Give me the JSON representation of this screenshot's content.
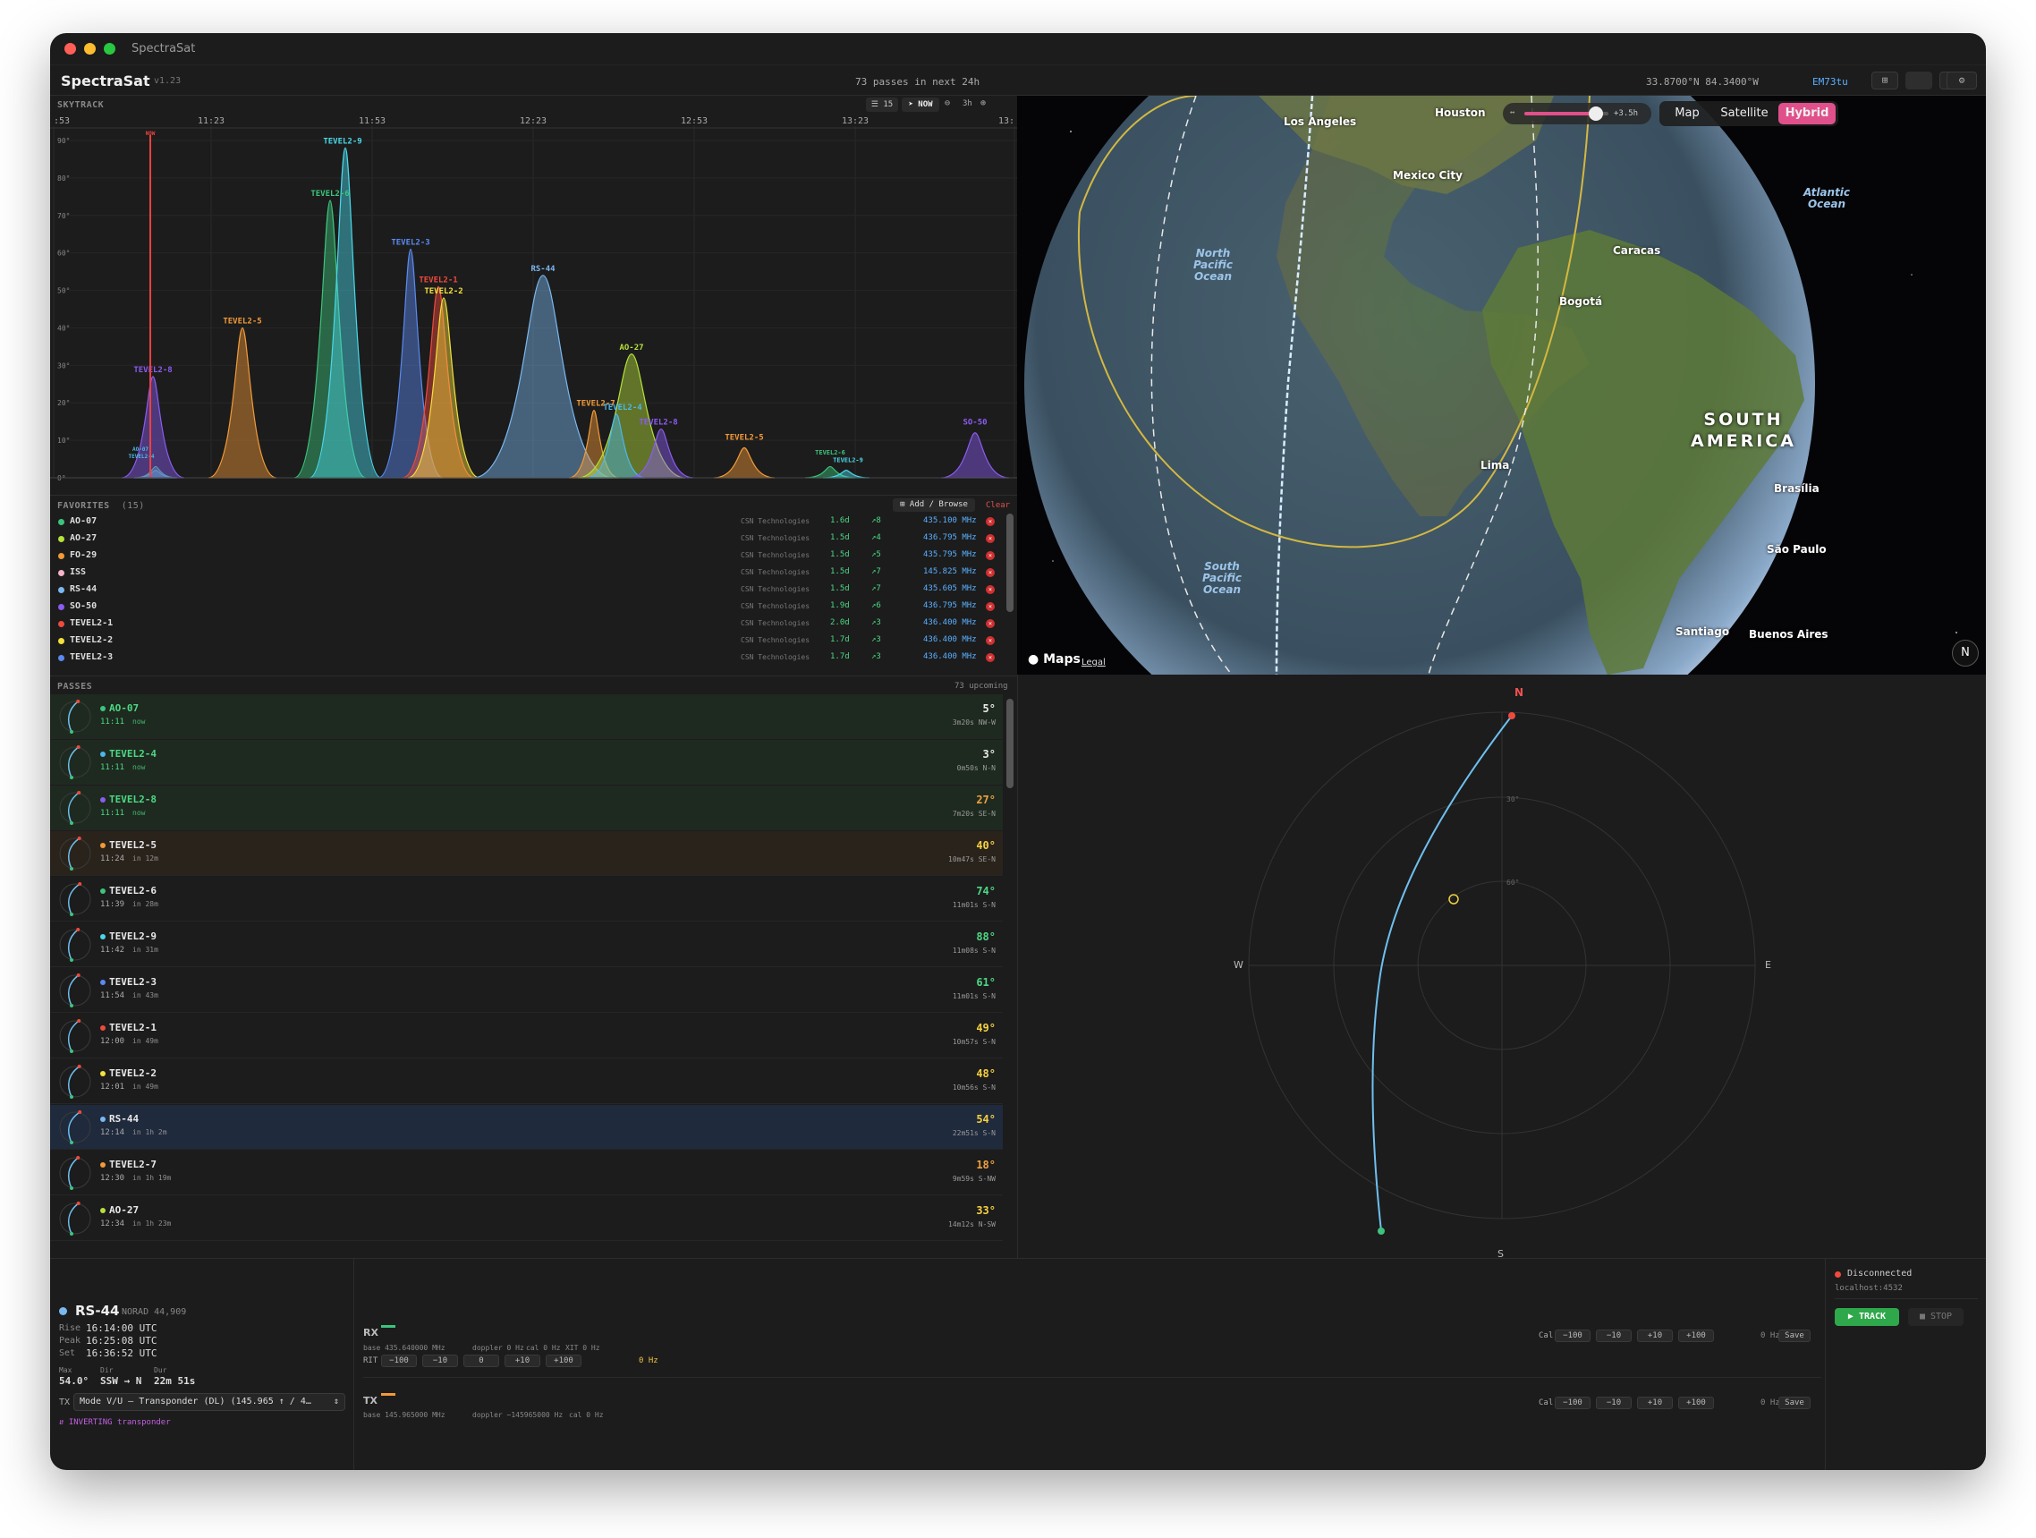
{
  "window": {
    "title": "SpectraSat"
  },
  "appbar": {
    "name": "SpectraSat",
    "version": "v1.23",
    "pass_count": "73 passes in next 24h",
    "coords": "33.8700°N 84.3400°W",
    "grid": "EM73tu"
  },
  "skytrack": {
    "label": "SKYTRACK",
    "count_label": "15",
    "now_label": "NOW",
    "range_label": "3h",
    "time_ticks": [
      ":53",
      "11:23",
      "11:53",
      "12:23",
      "12:53",
      "13:23",
      "13:"
    ],
    "elev_ticks": [
      "90°",
      "80°",
      "70°",
      "60°",
      "50°",
      "40°",
      "30°",
      "20°",
      "10°",
      "0°"
    ],
    "now_marker": "NOW",
    "peak_labels": [
      "TEVEL2-9",
      "TEVEL2-6",
      "TEVEL2-3",
      "TEVEL2-1",
      "TEVEL2-2",
      "TEVEL2-5",
      "RS-44",
      "AO-27",
      "TEVEL2-8",
      "TEVEL2-7",
      "TEVEL2-4",
      "TEVEL2-8",
      "TEVEL2-5",
      "SO-50",
      "TEVEL2-6",
      "TEVEL2-9",
      "AO-07",
      "TEVEL2-4"
    ]
  },
  "favorites": {
    "label": "FAVORITES",
    "count": "(15)",
    "add_label": "Add / Browse",
    "clear_label": "Clear",
    "items": [
      {
        "name": "AO-07",
        "color": "#3cc47c",
        "source": "CSN Technologies",
        "age": "1.6d",
        "passes": "↗8",
        "freq": "435.100 MHz"
      },
      {
        "name": "AO-27",
        "color": "#b6e03c",
        "source": "CSN Technologies",
        "age": "1.5d",
        "passes": "↗4",
        "freq": "436.795 MHz"
      },
      {
        "name": "FO-29",
        "color": "#f29a38",
        "source": "CSN Technologies",
        "age": "1.5d",
        "passes": "↗5",
        "freq": "435.795 MHz"
      },
      {
        "name": "ISS",
        "color": "#f5b4c8",
        "source": "CSN Technologies",
        "age": "1.5d",
        "passes": "↗7",
        "freq": "145.825 MHz"
      },
      {
        "name": "RS-44",
        "color": "#7ab8f0",
        "source": "CSN Technologies",
        "age": "1.5d",
        "passes": "↗7",
        "freq": "435.605 MHz"
      },
      {
        "name": "SO-50",
        "color": "#8a5cf0",
        "source": "CSN Technologies",
        "age": "1.9d",
        "passes": "↗6",
        "freq": "436.795 MHz"
      },
      {
        "name": "TEVEL2-1",
        "color": "#f04a3c",
        "source": "CSN Technologies",
        "age": "2.0d",
        "passes": "↗3",
        "freq": "436.400 MHz"
      },
      {
        "name": "TEVEL2-2",
        "color": "#f5e03c",
        "source": "CSN Technologies",
        "age": "1.7d",
        "passes": "↗3",
        "freq": "436.400 MHz"
      },
      {
        "name": "TEVEL2-3",
        "color": "#5a8af0",
        "source": "CSN Technologies",
        "age": "1.7d",
        "passes": "↗3",
        "freq": "436.400 MHz"
      }
    ]
  },
  "passes": {
    "label": "PASSES",
    "upcoming": "73 upcoming",
    "items": [
      {
        "name": "AO-07",
        "color": "#3cc47c",
        "time": "11:11",
        "rel": "now",
        "elev": "5°",
        "elev_color": "#e8e8e8",
        "dur": "3m20s NW-W",
        "bg": "#1e2a1f",
        "name_color": "#4cd884",
        "time_color": "#4cd884"
      },
      {
        "name": "TEVEL2-4",
        "color": "#4ab8e8",
        "time": "11:11",
        "rel": "now",
        "elev": "3°",
        "elev_color": "#e8e8e8",
        "dur": "0m50s N-N",
        "bg": "#1e2a1f",
        "name_color": "#4cd884",
        "time_color": "#4cd884"
      },
      {
        "name": "TEVEL2-8",
        "color": "#8a5cf0",
        "time": "11:11",
        "rel": "now",
        "elev": "27°",
        "elev_color": "#f0a040",
        "dur": "7m20s SE-N",
        "bg": "#1e2a1f",
        "name_color": "#4cd884",
        "time_color": "#4cd884"
      },
      {
        "name": "TEVEL2-5",
        "color": "#f29a38",
        "time": "11:24",
        "rel": "in 12m",
        "elev": "40°",
        "elev_color": "#f5d040",
        "dur": "10m47s SE-N",
        "bg": "#2a231c",
        "name_color": "#e8e8e8",
        "time_color": "#aaaaaa"
      },
      {
        "name": "TEVEL2-6",
        "color": "#3cc47c",
        "time": "11:39",
        "rel": "in 28m",
        "elev": "74°",
        "elev_color": "#4cd884",
        "dur": "11m01s S-N",
        "bg": "#1c1c1c",
        "name_color": "#e8e8e8",
        "time_color": "#aaaaaa"
      },
      {
        "name": "TEVEL2-9",
        "color": "#4ad8e8",
        "time": "11:42",
        "rel": "in 31m",
        "elev": "88°",
        "elev_color": "#4cd884",
        "dur": "11m08s S-N",
        "bg": "#1c1c1c",
        "name_color": "#e8e8e8",
        "time_color": "#aaaaaa"
      },
      {
        "name": "TEVEL2-3",
        "color": "#5a8af0",
        "time": "11:54",
        "rel": "in 43m",
        "elev": "61°",
        "elev_color": "#4cd884",
        "dur": "11m01s S-N",
        "bg": "#1c1c1c",
        "name_color": "#e8e8e8",
        "time_color": "#aaaaaa"
      },
      {
        "name": "TEVEL2-1",
        "color": "#f04a3c",
        "time": "12:00",
        "rel": "in 49m",
        "elev": "49°",
        "elev_color": "#f5d040",
        "dur": "10m57s S-N",
        "bg": "#1c1c1c",
        "name_color": "#e8e8e8",
        "time_color": "#aaaaaa"
      },
      {
        "name": "TEVEL2-2",
        "color": "#f5e03c",
        "time": "12:01",
        "rel": "in 49m",
        "elev": "48°",
        "elev_color": "#f5d040",
        "dur": "10m56s S-N",
        "bg": "#1c1c1c",
        "name_color": "#e8e8e8",
        "time_color": "#aaaaaa"
      },
      {
        "name": "RS-44",
        "color": "#7ab8f0",
        "time": "12:14",
        "rel": "in 1h 2m",
        "elev": "54°",
        "elev_color": "#f5d040",
        "dur": "22m51s S-N",
        "bg": "#1f2a3c",
        "name_color": "#e8e8e8",
        "time_color": "#aaaaaa"
      },
      {
        "name": "TEVEL2-7",
        "color": "#f29a38",
        "time": "12:30",
        "rel": "in 1h 19m",
        "elev": "18°",
        "elev_color": "#f0a040",
        "dur": "9m59s S-NW",
        "bg": "#1c1c1c",
        "name_color": "#e8e8e8",
        "time_color": "#aaaaaa"
      },
      {
        "name": "AO-27",
        "color": "#b6e03c",
        "time": "12:34",
        "rel": "in 1h 23m",
        "elev": "33°",
        "elev_color": "#f5d040",
        "dur": "14m12s N-SW",
        "bg": "#1c1c1c",
        "name_color": "#e8e8e8",
        "time_color": "#aaaaaa"
      }
    ]
  },
  "map": {
    "slider_left": "↔",
    "slider_right": "+3.5h",
    "modes": [
      "Map",
      "Satellite",
      "Hybrid"
    ],
    "active_mode": "Hybrid",
    "brand": "Maps",
    "legal": "Legal",
    "compass": "N",
    "cities": [
      "Los Angeles",
      "Houston",
      "Mexico City",
      "Caracas",
      "Bogotá",
      "Lima",
      "Brasília",
      "São Paulo",
      "Santiago",
      "Buenos Aires"
    ],
    "continent": "SOUTH AMERICA",
    "oceans": [
      "North Pacific Ocean",
      "Atlantic Ocean",
      "South Pacific Ocean"
    ]
  },
  "polar": {
    "north": "N",
    "south": "S",
    "east": "E",
    "west": "W",
    "ring30": "30°",
    "ring60": "60°"
  },
  "sat": {
    "name": "RS-44",
    "norad": "NORAD 44,909",
    "rise_label": "Rise",
    "rise": "16:14:00 UTC",
    "peak_label": "Peak",
    "peak": "16:25:08 UTC",
    "set_label": "Set",
    "set": "16:36:52 UTC",
    "max_label": "Max",
    "max": "54.0°",
    "dir_label": "Dir",
    "dir": "SSW → N",
    "dur_label": "Dur",
    "dur": "22m 51s",
    "tx_label": "TX",
    "mode": "Mode V/U – Transponder (DL) (145.965 ↑ / 4…",
    "inverting": "⇵ INVERTING transponder"
  },
  "radio": {
    "rx_label": "RX",
    "rx_base": "base 435.640000 MHz",
    "rx_doppler": "doppler 0 Hz",
    "rx_cal": "cal 0 Hz",
    "rx_xit": "XIT 0 Hz",
    "rit_label": "RIT",
    "rit_btns": [
      "−100",
      "−10",
      "0",
      "+10",
      "+100"
    ],
    "rit_value": "0 Hz",
    "cal_label": "Cal",
    "cal_btns": [
      "−100",
      "−10",
      "+10",
      "+100"
    ],
    "cal_value": "0 Hz",
    "save": "Save",
    "tx_label": "TX",
    "tx_base": "base 145.965000 MHz",
    "tx_doppler": "doppler −145965000 Hz",
    "tx_cal": "cal 0 Hz"
  },
  "conn": {
    "status": "Disconnected",
    "host": "localhost:4532",
    "track": "▶ TRACK",
    "stop": "■ STOP"
  }
}
